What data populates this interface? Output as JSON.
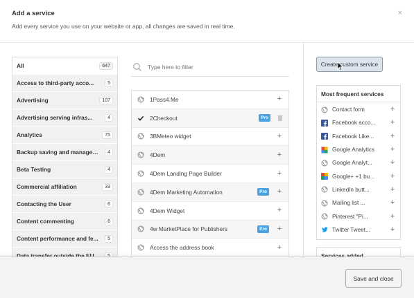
{
  "header": {
    "title": "Add a service",
    "subtitle": "Add every service you use on your website or app, all changes are saved in real time.",
    "close_glyph": "×"
  },
  "categories": [
    {
      "label": "All",
      "count": "647",
      "active": true
    },
    {
      "label": "Access to third-party acco...",
      "count": "5"
    },
    {
      "label": "Advertising",
      "count": "107"
    },
    {
      "label": "Advertising serving infras...",
      "count": "4"
    },
    {
      "label": "Analytics",
      "count": "75"
    },
    {
      "label": "Backup saving and management",
      "count": "4"
    },
    {
      "label": "Beta Testing",
      "count": "4"
    },
    {
      "label": "Commercial affiliation",
      "count": "33"
    },
    {
      "label": "Contacting the User",
      "count": "6"
    },
    {
      "label": "Content commenting",
      "count": "6"
    },
    {
      "label": "Content performance and fe...",
      "count": "5"
    },
    {
      "label": "Data transfer outside the EU",
      "count": "5"
    }
  ],
  "filter": {
    "placeholder": "Type here to filter",
    "icon": "search-icon"
  },
  "services": [
    {
      "label": "1Pass4.Me",
      "pro": false,
      "added": false
    },
    {
      "label": "2Checkout",
      "pro": true,
      "added": true
    },
    {
      "label": "3BMeteo widget",
      "pro": false,
      "added": false
    },
    {
      "label": "4Dem",
      "pro": false,
      "added": false
    },
    {
      "label": "4Dem Landing Page Builder",
      "pro": false,
      "added": false
    },
    {
      "label": "4Dem Marketing Automation",
      "pro": true,
      "added": false
    },
    {
      "label": "4Dem Widget",
      "pro": false,
      "added": false
    },
    {
      "label": "4w MarketPlace for Publishers",
      "pro": true,
      "added": false
    },
    {
      "label": "Access the address book",
      "pro": false,
      "added": false
    }
  ],
  "pro_label": "Pro",
  "right_panel": {
    "custom_button": "Create custom service",
    "frequent_title": "Most frequent services",
    "frequent": [
      {
        "label": "Contact form",
        "icon": "globe-icon"
      },
      {
        "label": "Facebook acco...",
        "icon": "facebook-icon"
      },
      {
        "label": "Facebook Like...",
        "icon": "facebook-icon"
      },
      {
        "label": "Google Analytics",
        "icon": "google-analytics-icon"
      },
      {
        "label": "Google Analyt...",
        "icon": "globe-icon"
      },
      {
        "label": "Google+ +1 bu...",
        "icon": "google-plus-icon"
      },
      {
        "label": "LinkedIn butt...",
        "icon": "globe-icon"
      },
      {
        "label": "Mailing list ...",
        "icon": "globe-icon"
      },
      {
        "label": "Pinterest \"Pi...",
        "icon": "globe-icon"
      },
      {
        "label": "Twitter Tweet...",
        "icon": "twitter-icon"
      }
    ],
    "added_title": "Services added"
  },
  "footer": {
    "save_label": "Save and close"
  },
  "colors": {
    "pro_badge": "#4aa3e0",
    "facebook": "#3b5998",
    "twitter": "#1da1f2",
    "google_plus": "#dd4b39",
    "custom_button_bg": "#dde3ea"
  }
}
